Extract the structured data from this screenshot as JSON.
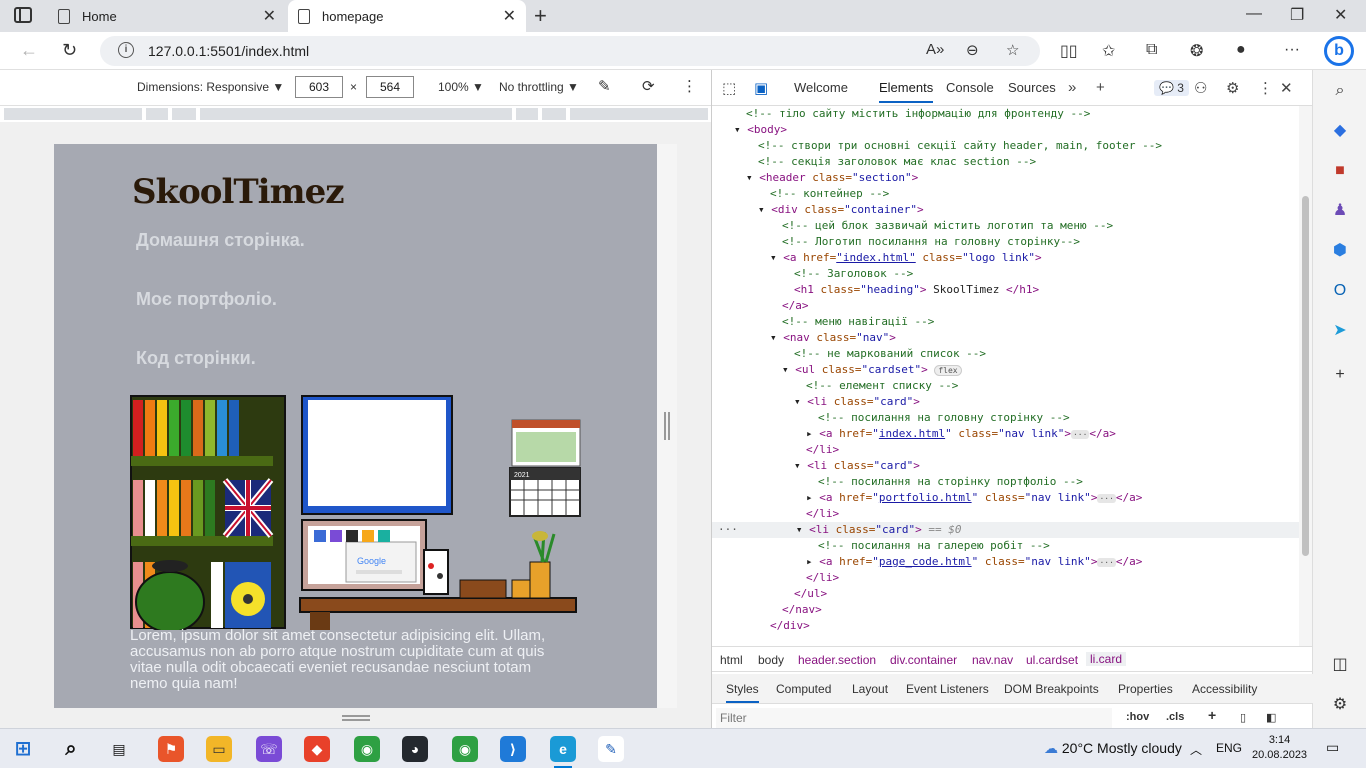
{
  "browser": {
    "tabs": [
      {
        "title": "Home"
      },
      {
        "title": "homepage"
      }
    ],
    "url": "127.0.0.1:5501/index.html"
  },
  "device_toolbar": {
    "dimensions_label": "Dimensions: Responsive",
    "width": "603",
    "height": "564",
    "times": "×",
    "zoom": "100%",
    "throttling": "No throttling"
  },
  "page": {
    "logo": "SkoolTimez",
    "nav_links": [
      "Домашня сторінка.",
      "Моє портфоліо.",
      "Код сторінки."
    ],
    "lorem": "Lorem, ipsum dolor sit amet consectetur adipisicing elit. Ullam, accusamus non ab porro atque nostrum cupiditate cum at quis vitae nulla odit obcaecati eveniet recusandae nesciunt totam nemo quia nam!",
    "illustration": {
      "search_brand": "Google",
      "calendar_year": "2021"
    }
  },
  "devtools": {
    "tabs": [
      "Welcome",
      "Elements",
      "Console",
      "Sources"
    ],
    "issues_count": "3",
    "breadcrumbs": [
      "html",
      "body",
      "header.section",
      "div.container",
      "nav.nav",
      "ul.cardset",
      "li.card"
    ],
    "lower_tabs": [
      "Styles",
      "Computed",
      "Layout",
      "Event Listeners",
      "DOM Breakpoints",
      "Properties",
      "Accessibility"
    ],
    "filter_placeholder": "Filter",
    "filter_buttons": [
      ":hov",
      ".cls"
    ],
    "dom": {
      "l1": "<!-- тіло сайту містить інформацію для фронтенду -->",
      "l2": "<body>",
      "l3": "<!-- створи три основні секції сайту header, main, footer -->",
      "l4": "<!-- секція заголовок має клас section -->",
      "l5_tag": "<header ",
      "l5_attr": "class=",
      "l5_val": "\"section\"",
      "l5_end": ">",
      "l6": "<!-- контейнер -->",
      "l7_tag": "<div ",
      "l7_attr": "class=",
      "l7_val": "\"container\"",
      "l7_end": ">",
      "l8": "<!-- цей блок зазвичай містить логотип та меню -->",
      "l9": "<!-- Логотип посилання на головну сторінку-->",
      "l10_tag": "<a ",
      "l10_attr": "href=",
      "l10_val": "\"index.html\"",
      "l10_attr2": " class=",
      "l10_val2": "\"logo link\"",
      "l10_end": ">",
      "l11": "<!-- Заголовок -->",
      "l12_tag": "<h1 ",
      "l12_attr": "class=",
      "l12_val": "\"heading\"",
      "l12_end": ">",
      "l12_text": " SkoolTimez ",
      "l12_close": "</h1>",
      "l13": "</a>",
      "l14": "<!-- меню навігації -->",
      "l15_tag": "<nav ",
      "l15_attr": "class=",
      "l15_val": "\"nav\"",
      "l15_end": ">",
      "l16": "<!-- не маркований список -->",
      "l17_tag": "<ul ",
      "l17_attr": "class=",
      "l17_val": "\"cardset\"",
      "l17_end": ">",
      "l17_badge": "flex",
      "l18": "<!-- елемент списку -->",
      "li_tag": "<li ",
      "li_attr": "class=",
      "li_val": "\"card\"",
      "li_end": ">",
      "l20": "<!-- посилання на головну сторінку -->",
      "a1_val": "index.html",
      "nav_link_attr": " class=",
      "nav_link_val": "\"nav link\"",
      "a_close": "</a>",
      "li_close": "</li>",
      "l23": "<!-- посилання на сторінку портфоліо -->",
      "a2_val": "portfolio.html",
      "sel_eq": " == $0",
      "l27": "<!-- посилання на галерею робіт -->",
      "a3_val": "page_code.html",
      "ul_close": "</ul>",
      "nav_close": "</nav>",
      "div_close": "</div>",
      "ellipsis": "···"
    }
  },
  "taskbar": {
    "weather": "20°C  Mostly cloudy",
    "language": "ENG",
    "time": "3:14",
    "date": "20.08.2023"
  },
  "colors": {
    "page_bg": "#a6a9b2",
    "nav_text": "#d7dadf",
    "logo": "#2a1a0a",
    "devtools_accent": "#0b62c4",
    "comment": "#236e25",
    "tag": "#881280"
  }
}
